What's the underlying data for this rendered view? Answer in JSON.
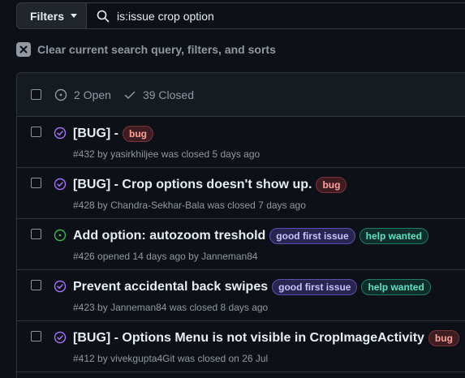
{
  "search": {
    "filters_label": "Filters",
    "query": "is:issue crop option"
  },
  "clear_filters": "Clear current search query, filters, and sorts",
  "header": {
    "open_count": "2 Open",
    "closed_count": "39 Closed"
  },
  "colors": {
    "closed_icon": "#a371f7",
    "open_icon": "#3fb950",
    "muted": "#9198a1"
  },
  "issues": [
    {
      "state": "closed",
      "icon": "issue-closed-icon",
      "title": "[BUG] -",
      "labels": [
        {
          "text": "bug",
          "kind": "bug"
        }
      ],
      "number": "#432",
      "by": "by",
      "author": "yasirkhiljee",
      "status": "was closed 5 days ago"
    },
    {
      "state": "closed",
      "icon": "issue-closed-icon",
      "title": "[BUG] - Crop options doesn't show up.",
      "labels": [
        {
          "text": "bug",
          "kind": "bug"
        }
      ],
      "number": "#428",
      "by": "by",
      "author": "Chandra-Sekhar-Bala",
      "status": "was closed 7 days ago"
    },
    {
      "state": "open",
      "icon": "issue-opened-icon",
      "title": "Add option: autozoom treshold",
      "labels": [
        {
          "text": "good first issue",
          "kind": "gfi"
        },
        {
          "text": "help wanted",
          "kind": "hw"
        }
      ],
      "number": "#426",
      "opened": "opened 14 days ago by",
      "author": "Janneman84"
    },
    {
      "state": "closed",
      "icon": "issue-closed-icon",
      "title": "Prevent accidental back swipes",
      "labels": [
        {
          "text": "good first issue",
          "kind": "gfi"
        },
        {
          "text": "help wanted",
          "kind": "hw"
        }
      ],
      "number": "#423",
      "by": "by",
      "author": "Janneman84",
      "status": "was closed 8 days ago"
    },
    {
      "state": "closed",
      "icon": "issue-closed-icon",
      "title": "[BUG] - Options Menu is not visible in CropImageActivity",
      "labels": [
        {
          "text": "bug",
          "kind": "bug"
        }
      ],
      "number": "#412",
      "by": "by",
      "author": "vivekgupta4Git",
      "status": "was closed on 26 Jul"
    }
  ]
}
